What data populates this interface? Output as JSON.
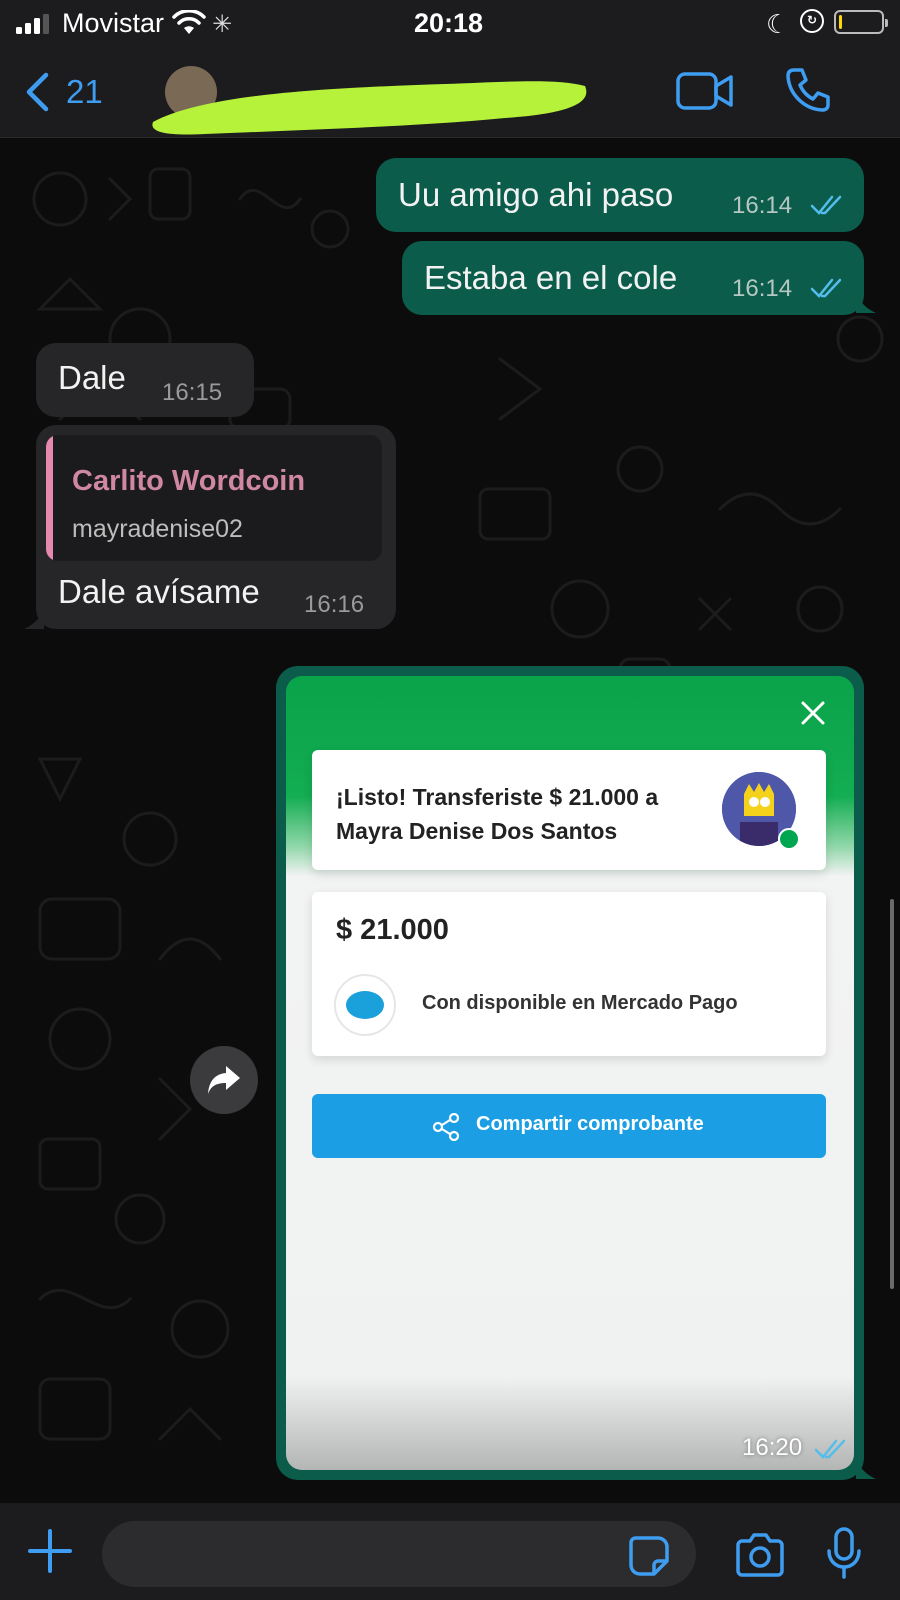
{
  "status_bar": {
    "carrier": "Movistar",
    "time": "20:18",
    "battery_level": 0.08,
    "battery_color": "#ffd60a"
  },
  "nav": {
    "back_count": "21",
    "contact_name": "",
    "icons": [
      "chevron-left-icon",
      "video-camera-icon",
      "phone-icon"
    ],
    "redaction_color": "#b6f23a",
    "accent_color": "#3e9df0"
  },
  "messages": [
    {
      "direction": "outgoing",
      "text": "Uu amigo ahi paso",
      "time": "16:14",
      "status": "read"
    },
    {
      "direction": "outgoing",
      "text": "Estaba en el cole",
      "time": "16:14",
      "status": "read"
    },
    {
      "direction": "incoming",
      "text": "Dale",
      "time": "16:15"
    },
    {
      "direction": "incoming",
      "text": "Dale avísame",
      "time": "16:16",
      "quoted": {
        "name": "Carlito Wordcoin",
        "text": "mayradenise02"
      }
    },
    {
      "direction": "outgoing",
      "type": "image",
      "time": "16:20",
      "status": "read"
    }
  ],
  "receipt": {
    "title": "¡Listo! Transferiste $ 21.000 a Mayra Denise Dos Santos",
    "amount": "$ 21.000",
    "source": "Con disponible en Mercado Pago",
    "share_button": "Compartir comprobante",
    "brand_green": "#0aa34a",
    "brand_blue": "#1b9ee3"
  },
  "input_bar": {
    "placeholder": "",
    "icons": [
      "plus-icon",
      "sticker-icon",
      "camera-icon",
      "microphone-icon"
    ]
  },
  "colors": {
    "outgoing_bubble": "#0b5c4b",
    "incoming_bubble": "#262628",
    "read_ticks": "#53bdeb"
  }
}
